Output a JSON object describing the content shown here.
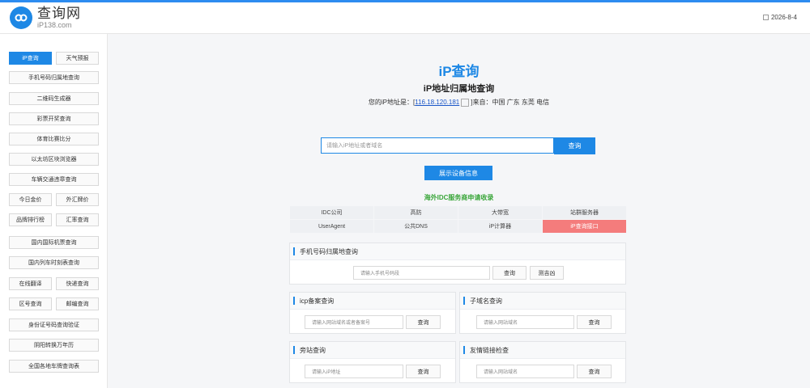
{
  "header": {
    "logo_cn": "查询网",
    "logo_en": "iP138.com",
    "date": "2026-8-4"
  },
  "sidebar": {
    "rows": [
      [
        "iP查询",
        "天气预报"
      ],
      [
        "手机号码归属地查询"
      ],
      [
        "二维码生成器"
      ],
      [
        "彩票开奖查询"
      ],
      [
        "体育比赛比分"
      ],
      [
        "以太坊区块浏览器"
      ],
      [
        "车辆交通违章查询"
      ],
      [
        "今日金价",
        "外汇牌价"
      ],
      [
        "品牌排行榜",
        "汇率查询"
      ],
      [
        "国内国际机票查询"
      ],
      [
        "国内列车时刻表查询"
      ],
      [
        "在线翻译",
        "快递查询"
      ],
      [
        "区号查询",
        "邮编查询"
      ],
      [
        "身份证号码查询验证"
      ],
      [
        "阴阳转换万年历"
      ],
      [
        "全国各地车牌查询表"
      ]
    ]
  },
  "main": {
    "title": "iP查询",
    "subtitle": "iP地址归属地查询",
    "my_ip_prefix": "您的iP地址是：[",
    "my_ip": "116.18.120.181",
    "my_ip_suffix": "]来自：中国 广东 东莞 电信",
    "search_placeholder": "请输入iP地址或者域名",
    "search_button": "查询",
    "device_button": "展示设备信息",
    "idc_title": "海外IDC服务商申请收录",
    "idc_rows": [
      [
        "IDC公司",
        "高防",
        "大带宽",
        "站群服务器"
      ],
      [
        "UserAgent",
        "公共DNS",
        "iP计算器",
        "iP查询接口"
      ]
    ]
  },
  "panels": {
    "phone": {
      "title": "手机号码归属地查询",
      "placeholder": "请输入手机号码段",
      "btn1": "查询",
      "btn2": "测吉凶"
    },
    "icp": {
      "title": "icp备案查询",
      "placeholder": "请输入网站域名或者备案号",
      "btn": "查询"
    },
    "subdomain": {
      "title": "子域名查询",
      "placeholder": "请输入网站域名",
      "btn": "查询"
    },
    "sidesite": {
      "title": "旁站查询",
      "placeholder": "请输入iP地址",
      "btn": "查询"
    },
    "friendlink": {
      "title": "友情链接检查",
      "placeholder": "请输入网站域名",
      "btn": "查询"
    }
  },
  "colors": {
    "accent": "#1e88e5",
    "hot": "#f47c7c",
    "idc_title": "#3aa63a"
  }
}
